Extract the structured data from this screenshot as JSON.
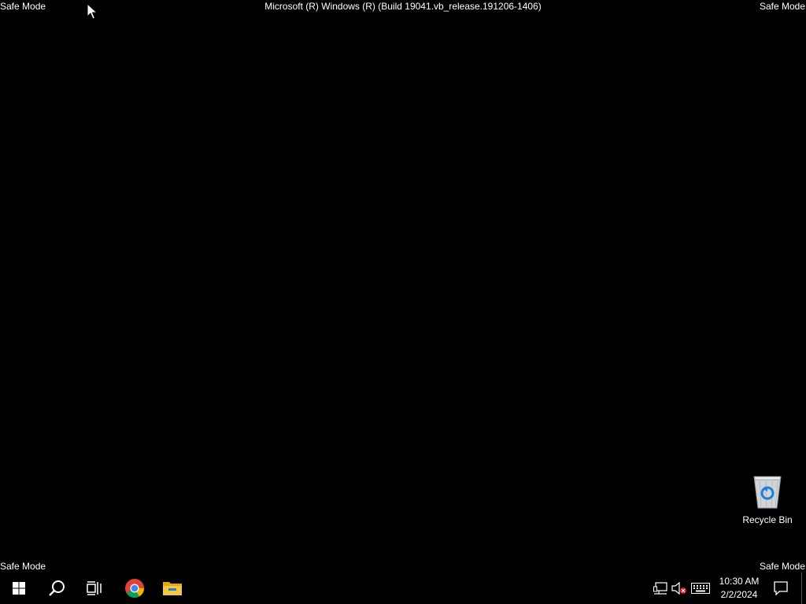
{
  "watermark": {
    "top_left": "Safe Mode",
    "top_right": "Safe Mode",
    "bottom_left": "Safe Mode",
    "bottom_right": "Safe Mode",
    "build": "Microsoft (R) Windows (R) (Build 19041.vb_release.191206-1406)"
  },
  "desktop": {
    "icons": [
      {
        "label": "Recycle Bin",
        "icon": "recycle-bin-icon"
      }
    ]
  },
  "taskbar": {
    "buttons": [
      {
        "name": "start",
        "icon": "windows-logo-icon"
      },
      {
        "name": "search",
        "icon": "search-icon"
      },
      {
        "name": "task-view",
        "icon": "task-view-icon"
      },
      {
        "name": "chrome",
        "icon": "chrome-icon"
      },
      {
        "name": "file-explorer",
        "icon": "folder-icon"
      }
    ],
    "tray": {
      "icons": [
        "network-icon",
        "volume-muted-icon",
        "keyboard-icon"
      ],
      "time": "10:30 AM",
      "date": "2/2/2024",
      "notification_icon": "notification-icon"
    }
  },
  "colors": {
    "background": "#000000",
    "text": "#ffffff",
    "windows_logo": "#ffffff",
    "folder": "#f0c040",
    "mute_badge": "#e81123"
  }
}
